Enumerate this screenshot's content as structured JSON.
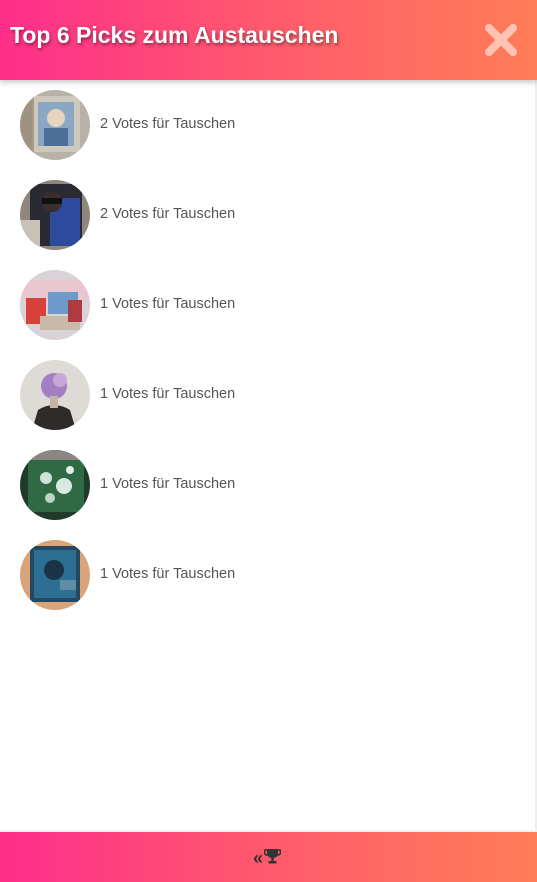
{
  "header": {
    "title": "Top 6 Picks zum Austauschen",
    "close_icon": "close-x-icon"
  },
  "picks": [
    {
      "votes_label": "2 Votes für Tauschen",
      "image": "album-cover-photo"
    },
    {
      "votes_label": "2 Votes für Tauschen",
      "image": "album-cover-photo"
    },
    {
      "votes_label": "1 Votes für Tauschen",
      "image": "album-cover-photo"
    },
    {
      "votes_label": "1 Votes für Tauschen",
      "image": "album-cover-photo"
    },
    {
      "votes_label": "1 Votes für Tauschen",
      "image": "album-cover-photo"
    },
    {
      "votes_label": "1 Votes für Tauschen",
      "image": "album-cover-photo"
    }
  ],
  "footer": {
    "back_glyph": "«",
    "trophy_icon": "trophy-icon"
  },
  "colors": {
    "gradient_start": "#fe2e8a",
    "gradient_end": "#ff7d57",
    "text": "#555555"
  }
}
